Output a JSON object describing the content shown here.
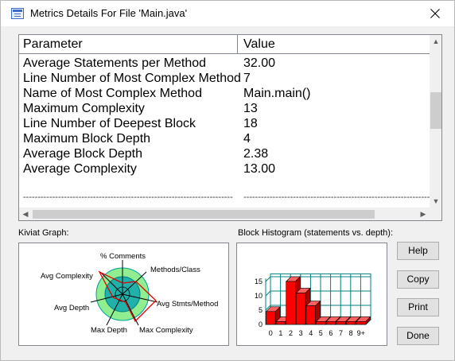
{
  "window": {
    "title": "Metrics Details For File 'Main.java'"
  },
  "table": {
    "headers": {
      "parameter": "Parameter",
      "value": "Value"
    },
    "rows": [
      {
        "parameter": "Average Statements per Method",
        "value": "32.00"
      },
      {
        "parameter": "Line Number of Most Complex Method",
        "value": "7"
      },
      {
        "parameter": "Name of Most Complex Method",
        "value": "Main.main()"
      },
      {
        "parameter": "Maximum Complexity",
        "value": "13"
      },
      {
        "parameter": "Line Number of Deepest Block",
        "value": "18"
      },
      {
        "parameter": "Maximum Block Depth",
        "value": "4"
      },
      {
        "parameter": "Average Block Depth",
        "value": "2.38"
      },
      {
        "parameter": "Average Complexity",
        "value": "13.00"
      }
    ],
    "separator": {
      "parameter": "------------------------------------------------------------------------",
      "value": "------------------------------------------------------------------------"
    }
  },
  "kiviat": {
    "label": "Kiviat Graph:",
    "axes": [
      "% Comments",
      "Methods/Class",
      "Avg Stmts/Method",
      "Max Complexity",
      "Max Depth",
      "Avg Depth",
      "Avg Complexity"
    ],
    "colors": {
      "outer": "#90ee90",
      "inner": "#20b2aa",
      "polygon": "#e00000"
    }
  },
  "histogram": {
    "label": "Block Histogram (statements vs. depth):",
    "y_ticks": [
      "0",
      "5",
      "10",
      "15"
    ],
    "ylim": [
      0,
      16
    ],
    "categories": [
      "0",
      "1",
      "2",
      "3",
      "4",
      "5",
      "6",
      "7",
      "8",
      "9+"
    ],
    "values": [
      4.5,
      1,
      15,
      11,
      6.5,
      1,
      1,
      1,
      1,
      1
    ],
    "colors": {
      "bar_front": "#ff0000",
      "bar_top": "#ff6060",
      "bar_side": "#b00000",
      "grid": "#008080"
    }
  },
  "buttons": {
    "help": "Help",
    "copy": "Copy",
    "print": "Print",
    "done": "Done"
  }
}
